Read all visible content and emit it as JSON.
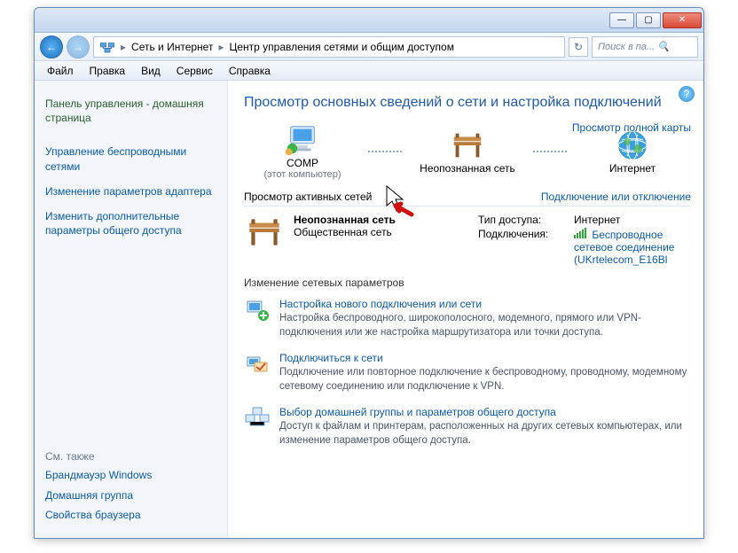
{
  "breadcrumb": {
    "seg1": "Сеть и Интернет",
    "seg2": "Центр управления сетями и общим доступом"
  },
  "search": {
    "placeholder": "Поиск в па..."
  },
  "menu": {
    "file": "Файл",
    "edit": "Правка",
    "view": "Вид",
    "tools": "Сервис",
    "help": "Справка"
  },
  "sidebar": {
    "home": "Панель управления - домашняя страница",
    "wireless": "Управление беспроводными сетями",
    "adapter": "Изменение параметров адаптера",
    "sharing": "Изменить дополнительные параметры общего доступа",
    "see_also": "См. также",
    "firewall": "Брандмауэр Windows",
    "homegroup": "Домашняя группа",
    "browser": "Свойства браузера"
  },
  "main": {
    "title": "Просмотр основных сведений о сети и настройка подключений",
    "full_map": "Просмотр полной карты",
    "node_comp": "COMP",
    "node_comp_sub": "(этот компьютер)",
    "node_unknown": "Неопознанная сеть",
    "node_internet": "Интернет",
    "active_head": "Просмотр активных сетей",
    "connect_link": "Подключение или отключение",
    "active_name": "Неопознанная сеть",
    "active_type": "Общественная сеть",
    "kv_access": "Тип доступа:",
    "kv_access_val": "Интернет",
    "kv_conn": "Подключения:",
    "kv_conn_val": "Беспроводное сетевое соединение (UKrtelecom_E16Bl",
    "change_head": "Изменение сетевых параметров",
    "task1_title": "Настройка нового подключения или сети",
    "task1_desc": "Настройка беспроводного, широкополосного, модемного, прямого или VPN-подключения или же настройка маршрутизатора или точки доступа.",
    "task2_title": "Подключиться к сети",
    "task2_desc": "Подключение или повторное подключение к беспроводному, проводному, модемному сетевому соединению или подключение к VPN.",
    "task3_title": "Выбор домашней группы и параметров общего доступа",
    "task3_desc": "Доступ к файлам и принтерам, расположенных на других сетевых компьютерах, или изменение параметров общего доступа."
  }
}
